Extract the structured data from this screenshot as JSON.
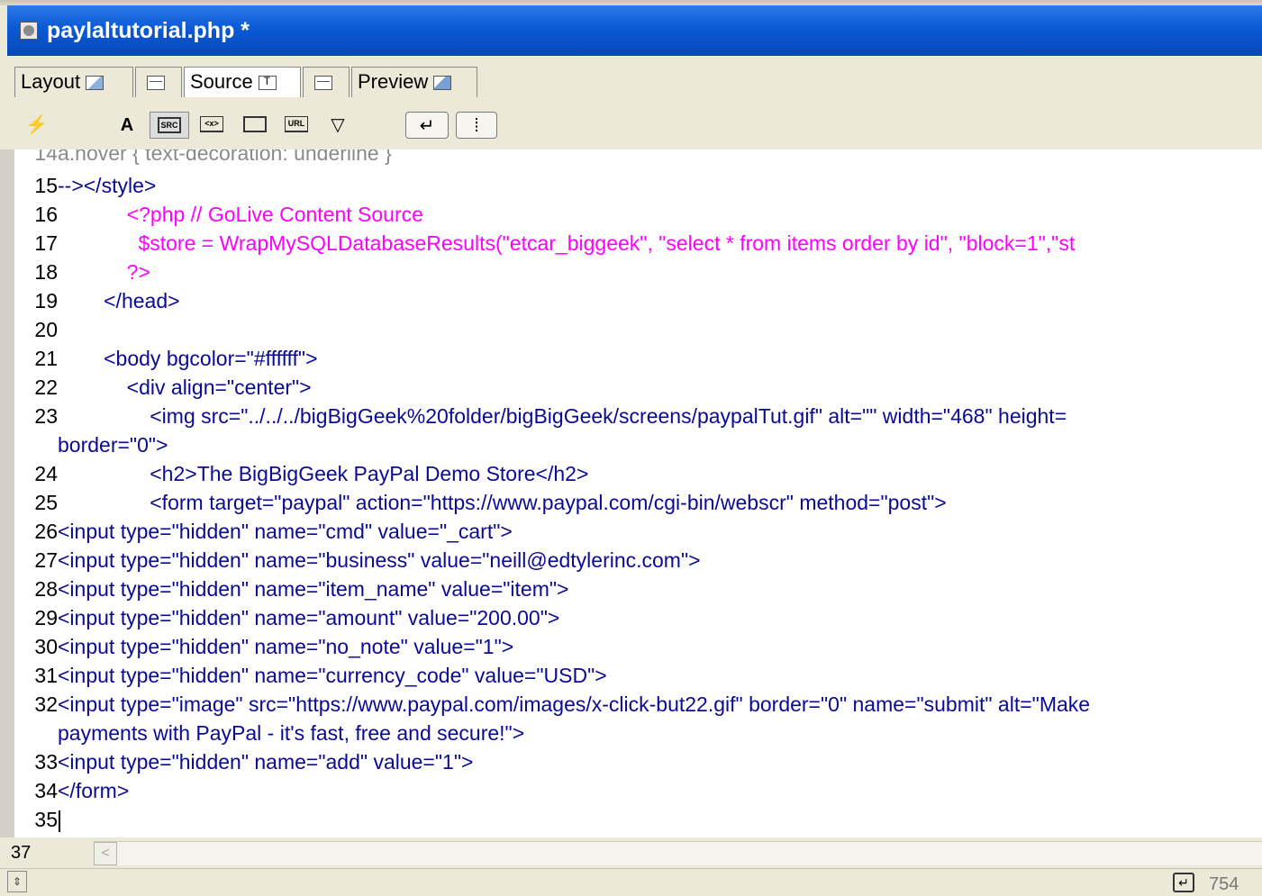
{
  "window": {
    "title": "paylaltutorial.php *"
  },
  "tabs": [
    {
      "label": "Layout",
      "active": false
    },
    {
      "label": "",
      "active": false
    },
    {
      "label": "Source",
      "active": true
    },
    {
      "label": "",
      "active": false
    },
    {
      "label": "Preview",
      "active": false
    }
  ],
  "toolbar": {
    "buttons": [
      "check-syntax",
      "font",
      "SRC",
      "<x>",
      "table",
      "URL",
      "color",
      "word-wrap",
      "line-numbers"
    ],
    "labels": {
      "font": "A",
      "src": "SRC",
      "tag": "<x>",
      "url": "URL"
    }
  },
  "editor": {
    "lines": [
      {
        "num": "14",
        "text": "a.hover { text-decoration: underline }"
      },
      {
        "num": "15",
        "text": "--></style>"
      },
      {
        "num": "16",
        "text": "            <?php // GoLive Content Source"
      },
      {
        "num": "17",
        "text": "              $store = WrapMySQLDatabaseResults(\"etcar_biggeek\", \"select * from items order by id\", \"block=1\",\"st"
      },
      {
        "num": "18",
        "text": "            ?>"
      },
      {
        "num": "19",
        "text": "        </head>"
      },
      {
        "num": "20",
        "text": ""
      },
      {
        "num": "21",
        "text": "        <body bgcolor=\"#ffffff\">"
      },
      {
        "num": "22",
        "text": "            <div align=\"center\">"
      },
      {
        "num": "23",
        "text": "                <img src=\"../../../bigBigGeek%20folder/bigBigGeek/screens/paypalTut.gif\" alt=\"\" width=\"468\" height="
      },
      {
        "num": "",
        "text": "border=\"0\">"
      },
      {
        "num": "24",
        "text": "                <h2>The BigBigGeek PayPal Demo Store</h2>"
      },
      {
        "num": "25",
        "text": "                <form target=\"paypal\" action=\"https://www.paypal.com/cgi-bin/webscr\" method=\"post\">"
      },
      {
        "num": "26",
        "text": "<input type=\"hidden\" name=\"cmd\" value=\"_cart\">"
      },
      {
        "num": "27",
        "text": "<input type=\"hidden\" name=\"business\" value=\"neill@edtylerinc.com\">"
      },
      {
        "num": "28",
        "text": "<input type=\"hidden\" name=\"item_name\" value=\"item\">"
      },
      {
        "num": "29",
        "text": "<input type=\"hidden\" name=\"amount\" value=\"200.00\">"
      },
      {
        "num": "30",
        "text": "<input type=\"hidden\" name=\"no_note\" value=\"1\">"
      },
      {
        "num": "31",
        "text": "<input type=\"hidden\" name=\"currency_code\" value=\"USD\">"
      },
      {
        "num": "32",
        "text": "<input type=\"image\" src=\"https://www.paypal.com/images/x-click-but22.gif\" border=\"0\" name=\"submit\" alt=\"Make"
      },
      {
        "num": "",
        "text": "payments with PayPal - it's fast, free and secure!\">"
      },
      {
        "num": "33",
        "text": "<input type=\"hidden\" name=\"add\" value=\"1\">"
      },
      {
        "num": "34",
        "text": "</form>"
      },
      {
        "num": "35",
        "text": ""
      }
    ]
  },
  "status": {
    "line_count": "37",
    "file_size": "754"
  },
  "colors": {
    "title_bar": "#0a59d6",
    "tag_text": "#0a0a96",
    "php_text": "#ff00ff"
  }
}
